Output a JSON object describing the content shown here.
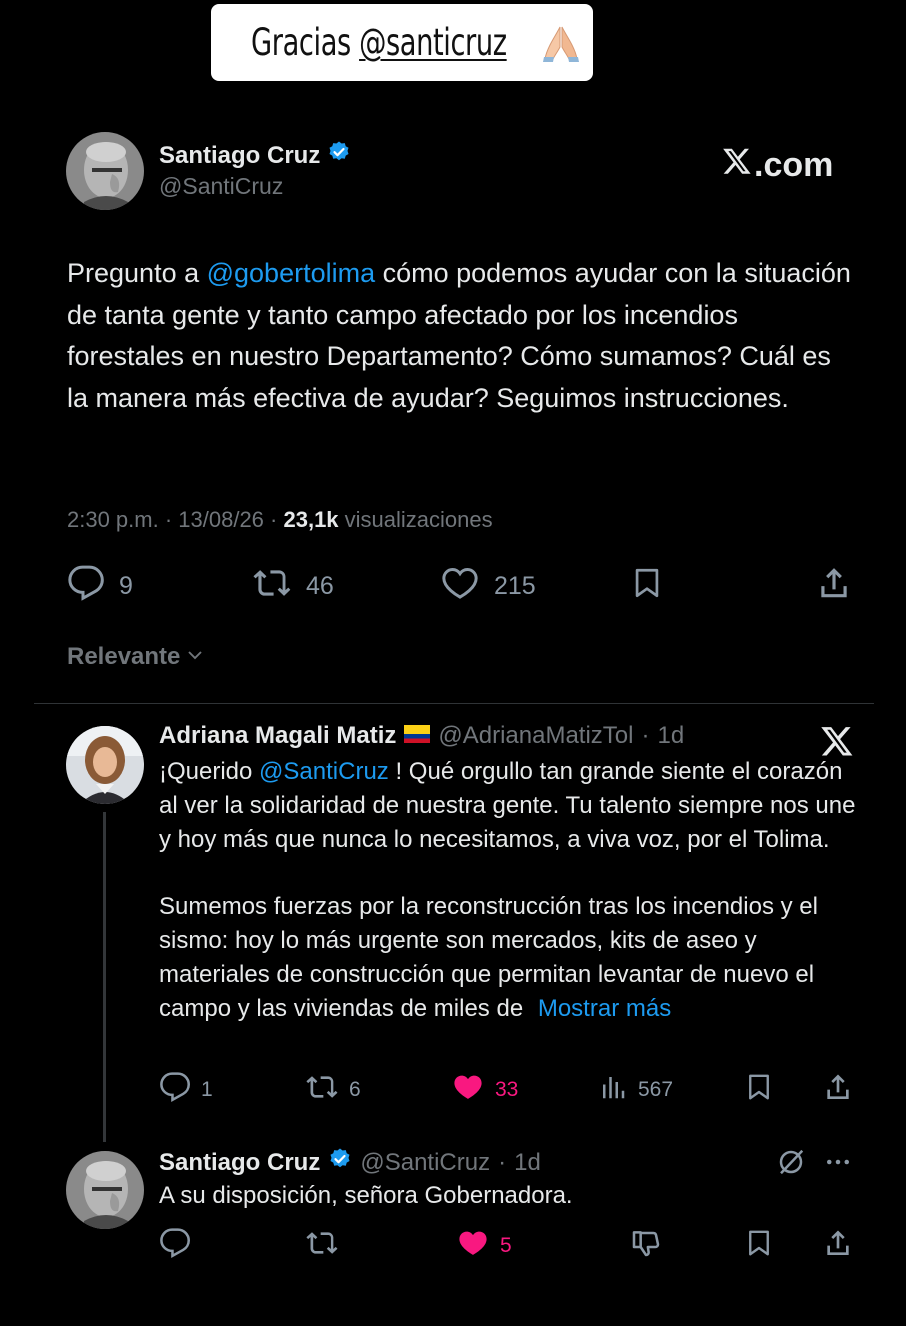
{
  "sticker": {
    "text_prefix": "Gracias ",
    "mention": "@santicruz"
  },
  "main_tweet": {
    "author_name": "Santiago Cruz",
    "author_handle": "@SantiCruz",
    "brand": ".com",
    "body": {
      "prefix": "Pregunto a ",
      "mention": "@gobertolima",
      "rest": " cómo podemos ayudar con la situación de tanta gente y tanto campo afectado por los incendios forestales en nuestro Departamento? Cómo sumamos? Cuál es la manera más efectiva de ayudar? Seguimos instrucciones."
    },
    "time": "2:30 p.m.",
    "date": "13/08/26",
    "views_count": "23,1k",
    "views_label": "visualizaciones",
    "replies": "9",
    "reposts": "46",
    "likes": "215"
  },
  "sort": {
    "label": "Relevante"
  },
  "reply": {
    "author_name": "Adriana Magali Matiz",
    "author_handle": "@AdrianaMatizTol",
    "age": "1d",
    "body": {
      "p1_prefix": "¡Querido ",
      "p1_mention": "@SantiCruz",
      "p1_rest": " ! Qué orgullo tan grande siente el corazón al ver la solidaridad de nuestra gente. Tu talento siempre nos une y hoy más que nunca lo necesitamos, a viva voz, por el Tolima.",
      "p2": "Sumemos fuerzas por la reconstrucción tras los incendios y el sismo: hoy lo más urgente son mercados, kits de aseo y materiales de construcción que permitan levantar de nuevo el campo y las viviendas de miles de ",
      "show_more": "Mostrar más"
    },
    "replies": "1",
    "reposts": "6",
    "likes": "33",
    "views": "567"
  },
  "reply2": {
    "author_name": "Santiago Cruz",
    "author_handle": "@SantiCruz",
    "age": "1d",
    "body": "A su disposición, señora Gobernadora.",
    "likes": "5"
  },
  "colors": {
    "accent": "#1d9bf0",
    "like": "#f91880",
    "muted": "#71767b"
  }
}
